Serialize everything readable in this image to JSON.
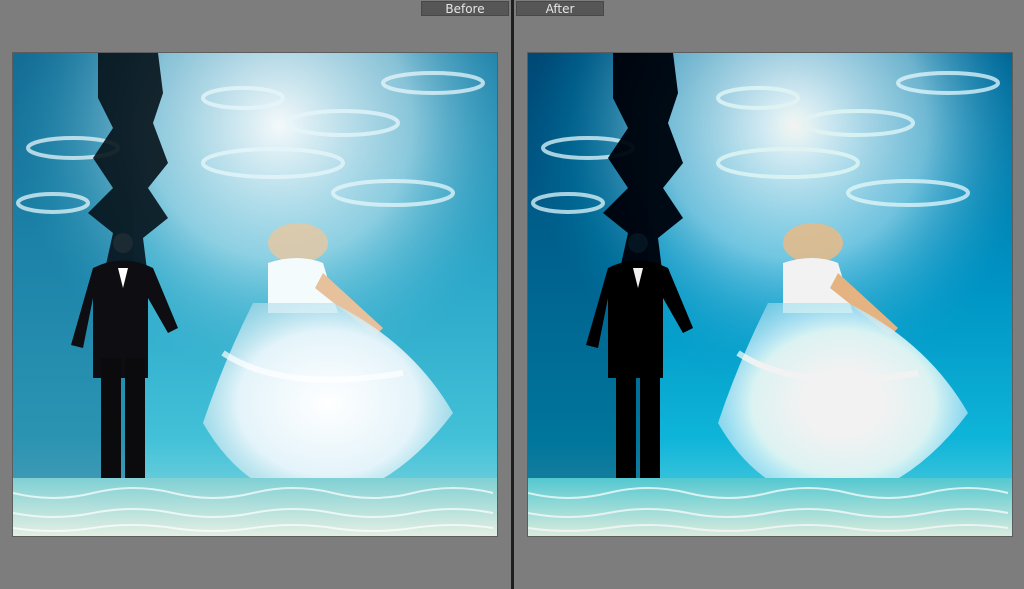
{
  "compare_view": {
    "before_label": "Before",
    "after_label": "After"
  },
  "colors": {
    "background": "#7c7c7c",
    "divider": "#1e1e1e",
    "label_bg": "#565656",
    "label_text": "#e6e6e6",
    "water_deep": "#0f4f73",
    "water_light": "#3bb7d6",
    "dress": "#e9f6fb",
    "suit": "#0e0e12"
  },
  "images": {
    "before": "underwater-wedding-photo-before",
    "after": "underwater-wedding-photo-after"
  }
}
